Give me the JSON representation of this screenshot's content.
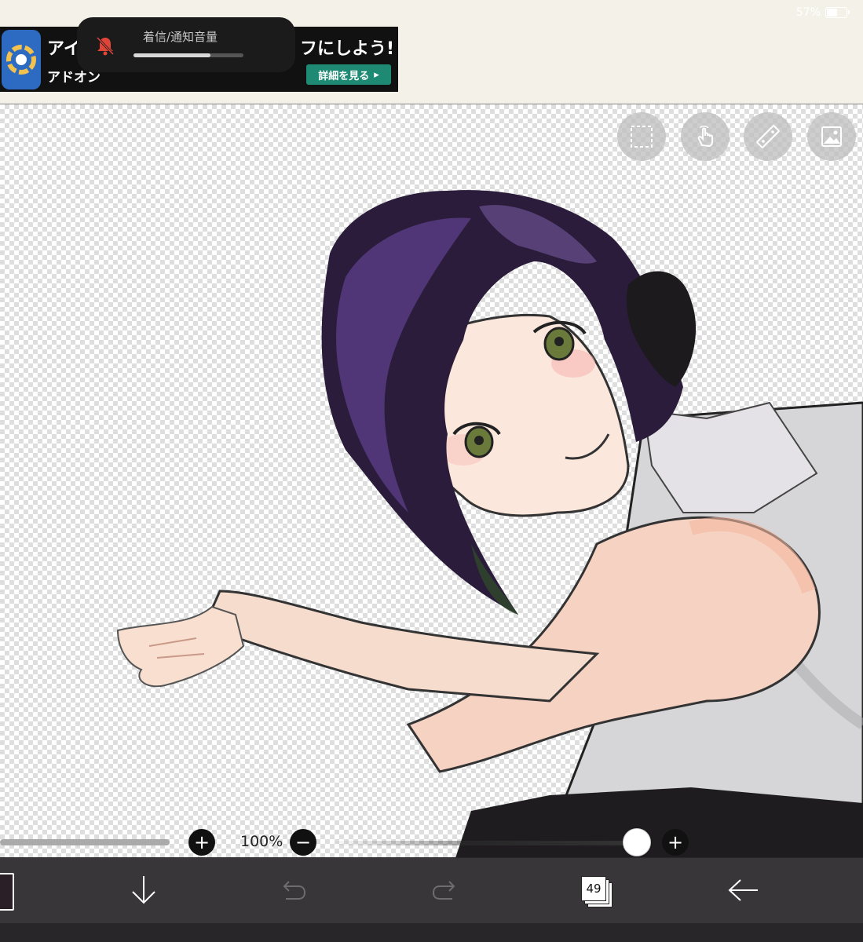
{
  "status_bar": {
    "battery": "57%"
  },
  "ad": {
    "title_left": "アイ",
    "title_right": "フにしよう!",
    "subtitle": "アドオン",
    "cta_label": "詳細を見る"
  },
  "volume_hud": {
    "label": "着信/通知音量",
    "level": 0.7
  },
  "canvas": {
    "tools": [
      "selection-icon",
      "gesture-hand-icon",
      "ruler-icon",
      "image-icon"
    ]
  },
  "controls": {
    "zoom": "100%",
    "brush_size_plus": "+",
    "opacity_minus": "−",
    "opacity_plus": "+",
    "opacity_level": 1.0
  },
  "toolbar": {
    "layer_count": "49",
    "items": [
      "color-swatch",
      "download-arrow-icon",
      "undo-icon",
      "redo-icon",
      "layers-icon",
      "back-arrow-icon"
    ]
  },
  "colors": {
    "current_color": "#2a1f27",
    "cta": "#1f8a74"
  }
}
